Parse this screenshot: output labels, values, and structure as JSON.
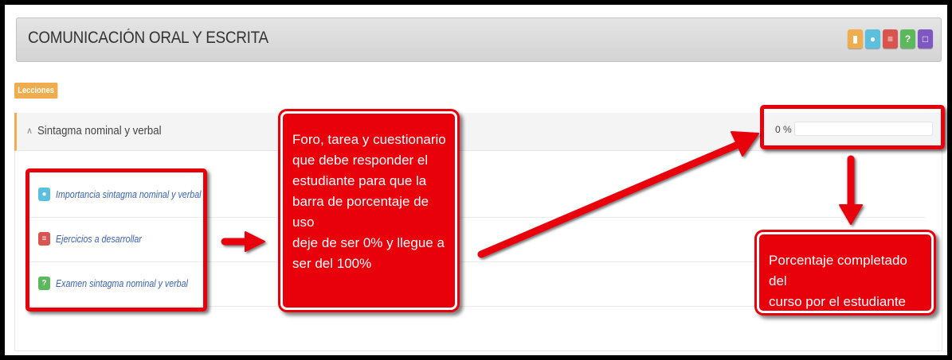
{
  "header": {
    "course_title": "COMUNICACIÓN ORAL Y ESCRITA",
    "icons": [
      {
        "name": "clipboard-icon",
        "glyph": "▮",
        "color": "#f0ad4e"
      },
      {
        "name": "chat-icon",
        "glyph": "●",
        "color": "#5bc0de"
      },
      {
        "name": "document-icon",
        "glyph": "≡",
        "color": "#d9534f"
      },
      {
        "name": "help-icon",
        "glyph": "?",
        "color": "#5cb85c"
      },
      {
        "name": "monitor-icon",
        "glyph": "□",
        "color": "#7e57c2"
      }
    ]
  },
  "section_tag": "Lecciones",
  "lesson": {
    "title": "Sintagma nominal y verbal",
    "progress_text": "0 %",
    "progress_value": 0
  },
  "activities": [
    {
      "label": "Importancia sintagma nominal y verbal",
      "icon": "forum-icon",
      "glyph": "●",
      "color": "#5bc0de"
    },
    {
      "label": "Ejercicios a desarrollar",
      "icon": "assignment-icon",
      "glyph": "≡",
      "color": "#d9534f"
    },
    {
      "label": "Examen sintagma nominal y verbal",
      "icon": "quiz-icon",
      "glyph": "?",
      "color": "#5cb85c"
    }
  ],
  "annotations": {
    "center_callout": "Foro, tarea y cuestionario\nque debe responder el\nestudiante para que la\nbarra de porcentaje de uso\ndeje de ser 0% y llegue a\nser del 100%",
    "right_callout": "Porcentaje completado del\ncurso por el estudiante",
    "accent_color": "#e8000b"
  }
}
